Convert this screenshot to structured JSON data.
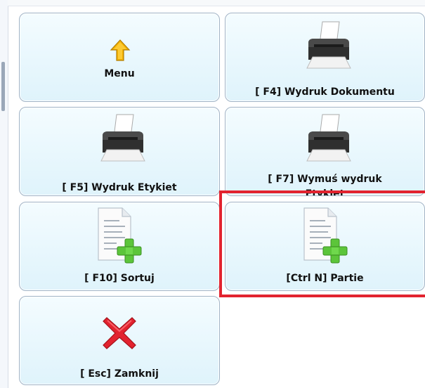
{
  "tiles": {
    "menu": {
      "label": "Menu",
      "icon": "arrow-up-icon"
    },
    "f4": {
      "label": "[ F4] Wydruk Dokumentu",
      "icon": "printer-icon"
    },
    "f5": {
      "label": "[ F5] Wydruk Etykiet",
      "icon": "printer-icon"
    },
    "f7": {
      "label": "[ F7] Wymuś wydruk",
      "label_line2": "Etykiet",
      "icon": "printer-icon"
    },
    "f10": {
      "label": "[ F10] Sortuj",
      "icon": "document-add-icon"
    },
    "ctrln": {
      "label": "[Ctrl N] Partie",
      "icon": "document-add-icon"
    },
    "esc": {
      "label": "[ Esc] Zamknij",
      "icon": "close-x-icon"
    }
  },
  "colors": {
    "tile_border": "#9fb3c6",
    "tile_bg": "#e8f7fd",
    "highlight": "#e2232f",
    "arrow": "#f5b400",
    "plus": "#5cc53a",
    "close": "#e2232f"
  }
}
